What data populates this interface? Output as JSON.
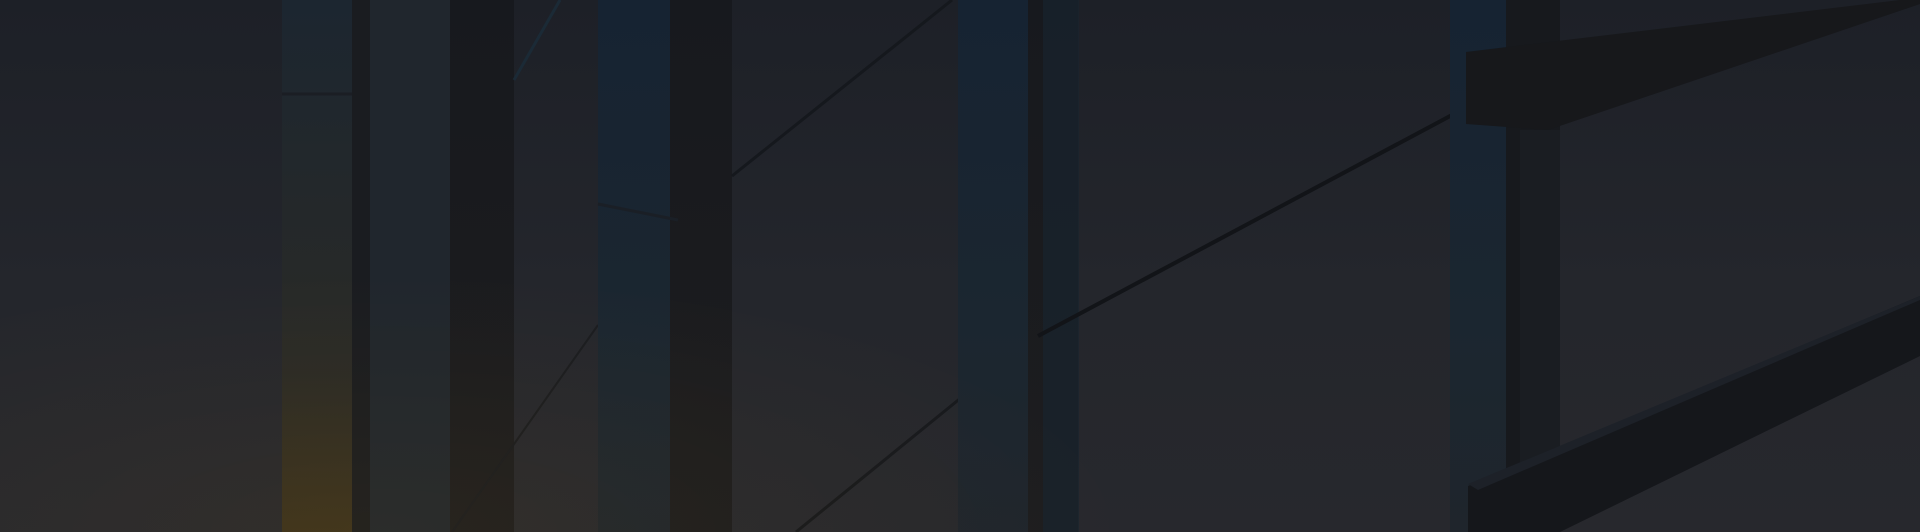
{
  "hero": {
    "kind": "architectural background banner",
    "tint": "dark",
    "colors": {
      "base": "#24262c",
      "shadow": "#16181d",
      "steel_blue": "#17232f",
      "warm_glow": "#4a3a1a"
    }
  }
}
